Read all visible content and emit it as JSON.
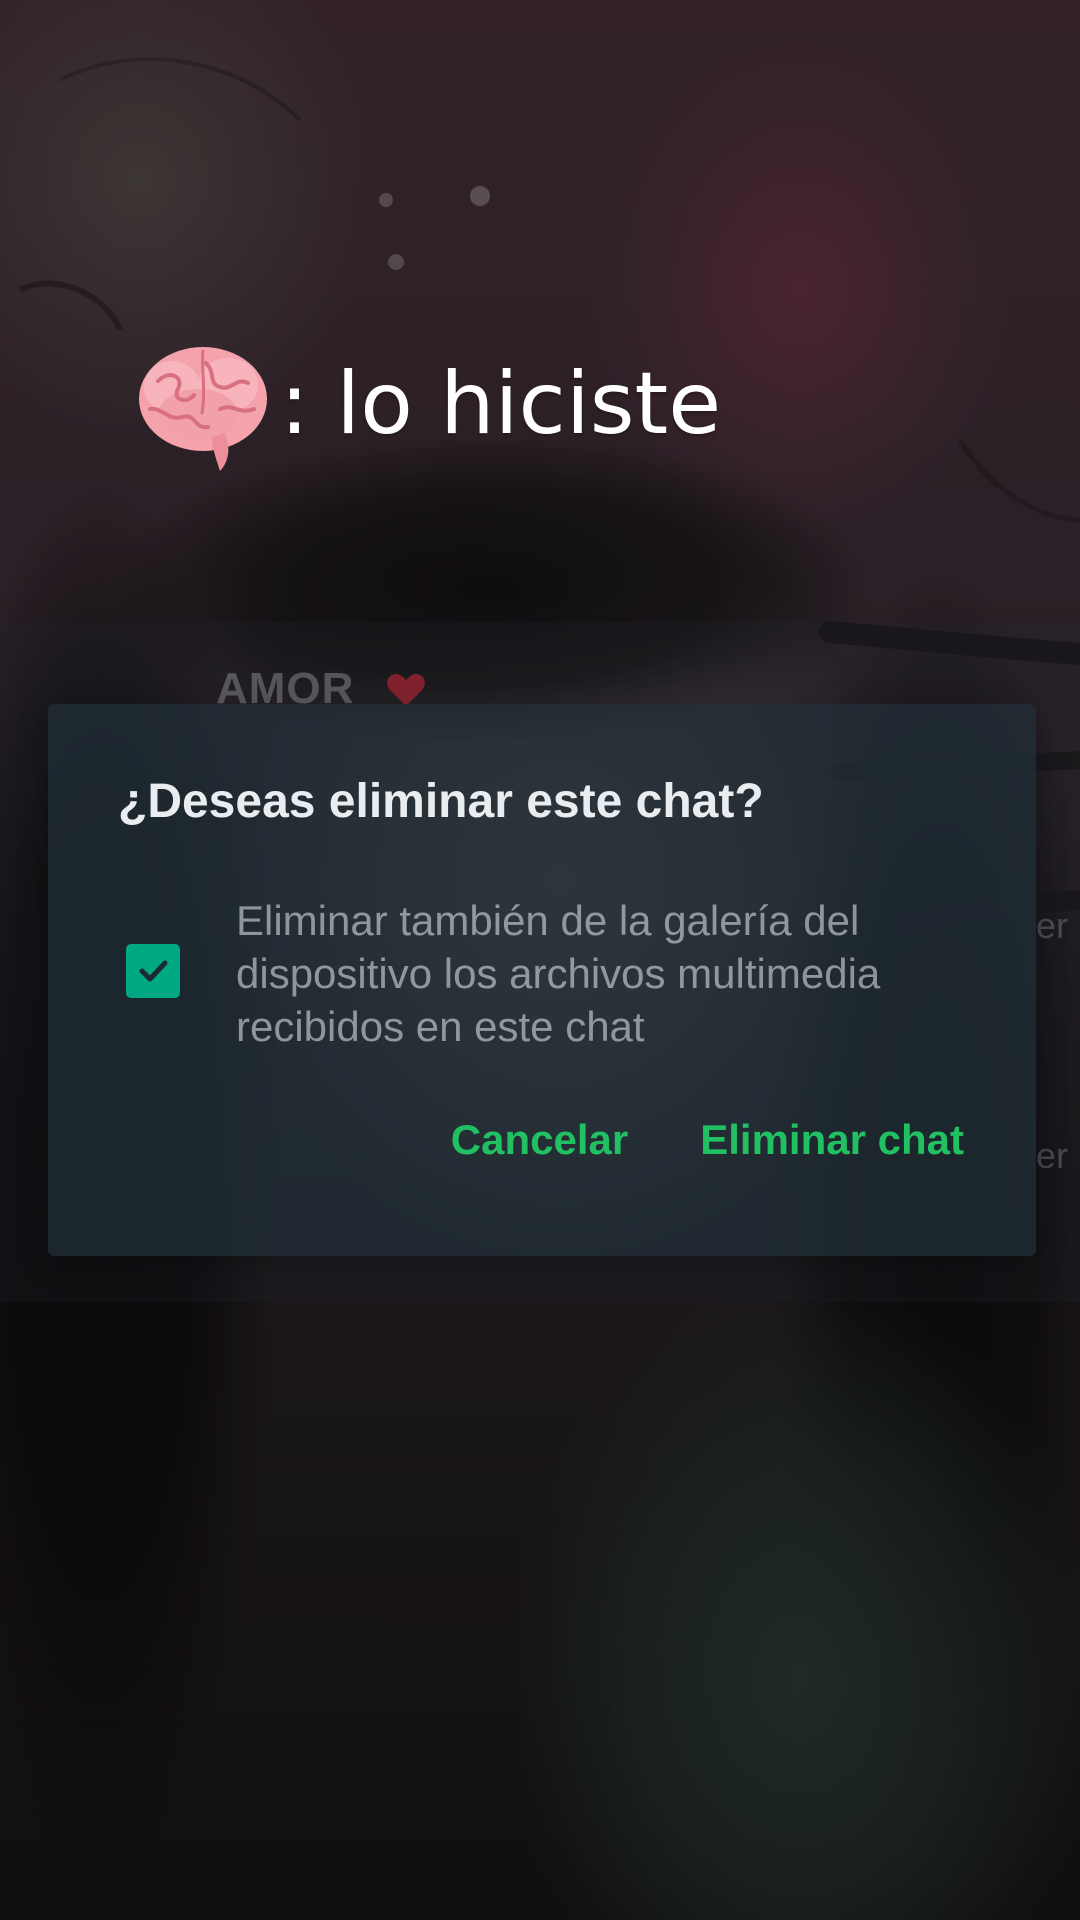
{
  "caption": {
    "emoji_icon": "brain-emoji",
    "text": ": lo hiciste"
  },
  "background_chat": {
    "contact_name": "AMOR",
    "heart_icon": "red-heart-emoji",
    "partial_text_1": "er",
    "partial_text_2": "er"
  },
  "dialog": {
    "title": "¿Deseas eliminar este chat?",
    "checkbox_checked": true,
    "option_text": "Eliminar también de la galería del dispositivo los archivos multimedia recibidos en este chat",
    "cancel_label": "Cancelar",
    "confirm_label": "Eliminar chat"
  },
  "colors": {
    "accent_green": "#21c063",
    "checkbox_green": "#00a884",
    "dialog_bg": "#212f38",
    "title_text": "#e9edef"
  }
}
